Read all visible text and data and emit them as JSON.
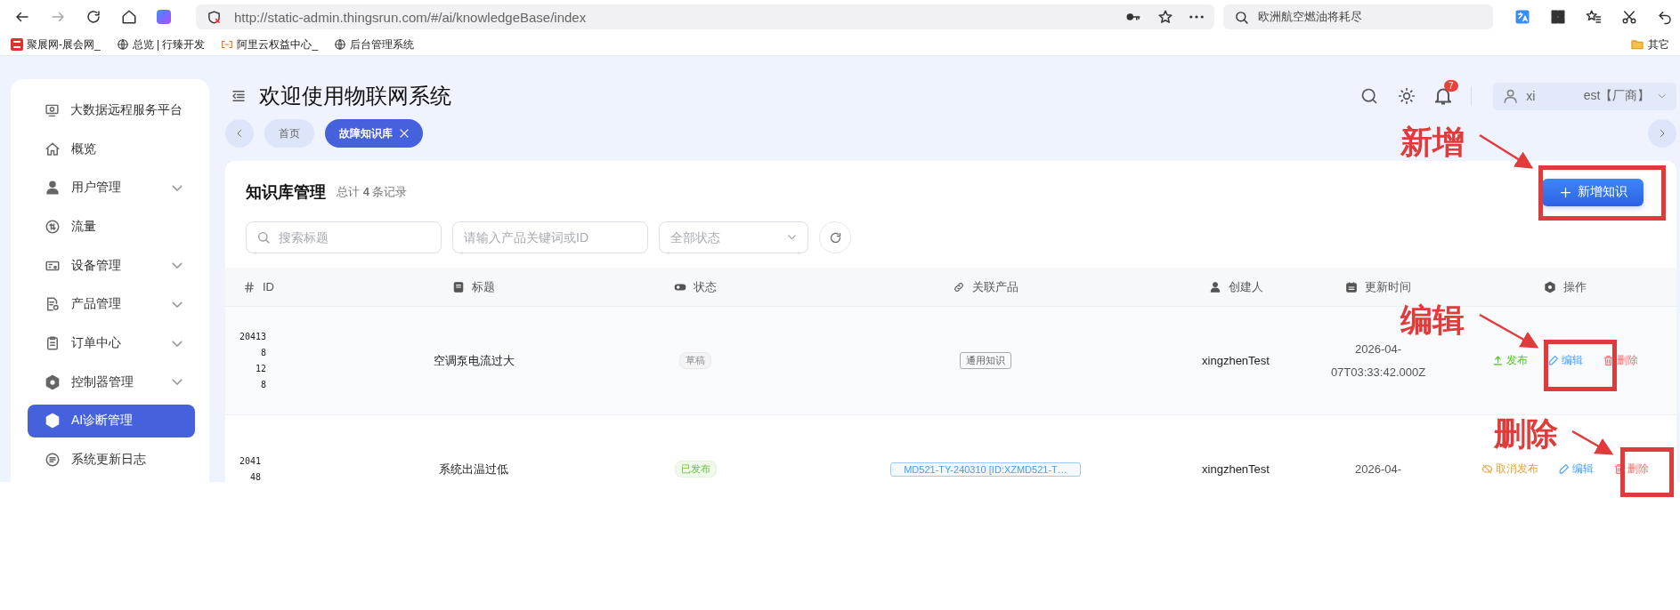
{
  "browser": {
    "url": "http://static-admin.thingsrun.com/#/ai/knowledgeBase/index",
    "search": "欧洲航空燃油将耗尽",
    "bookmarks": [
      {
        "label": "聚展网-展会网_",
        "kind": "expo"
      },
      {
        "label": "总览 | 行臻开发",
        "kind": "globe"
      },
      {
        "label": "阿里云权益中心_",
        "kind": "cloud"
      },
      {
        "label": "后台管理系统",
        "kind": "globe"
      }
    ],
    "other_bookmarks": "其它"
  },
  "sidebar": {
    "items": [
      {
        "label": "大数据远程服务平台",
        "kind": "monitor",
        "expandable": false,
        "selected": false
      },
      {
        "label": "概览",
        "kind": "home",
        "expandable": false,
        "selected": false
      },
      {
        "label": "用户管理",
        "kind": "user",
        "expandable": true,
        "selected": false
      },
      {
        "label": "流量",
        "kind": "flow",
        "expandable": false,
        "selected": false
      },
      {
        "label": "设备管理",
        "kind": "device",
        "expandable": true,
        "selected": false
      },
      {
        "label": "产品管理",
        "kind": "product",
        "expandable": true,
        "selected": false
      },
      {
        "label": "订单中心",
        "kind": "order",
        "expandable": true,
        "selected": false
      },
      {
        "label": "控制器管理",
        "kind": "gear",
        "expandable": true,
        "selected": false
      },
      {
        "label": "AI诊断管理",
        "kind": "gear",
        "expandable": false,
        "selected": true
      },
      {
        "label": "系统更新日志",
        "kind": "log",
        "expandable": false,
        "selected": false
      }
    ]
  },
  "header": {
    "title": "欢迎使用物联网系统",
    "notifications": "7",
    "user_start": "xi",
    "user_end": "est【厂商】"
  },
  "tabs": [
    {
      "label": "首页",
      "selected": false,
      "closable": false
    },
    {
      "label": "故障知识库",
      "selected": true,
      "closable": true
    }
  ],
  "card": {
    "title": "知识库管理",
    "count": "总计 **4** 条记录",
    "add_button": "新增知识"
  },
  "filters": {
    "title_placeholder": "搜索标题",
    "product_placeholder": "请输入产品关键词或ID",
    "status_placeholder": "全部状态"
  },
  "table": {
    "columns": [
      "ID",
      "标题",
      "状态",
      "关联产品",
      "创建人",
      "更新时间",
      "操作"
    ],
    "rows": [
      {
        "id_lines": [
          "20413",
          "8",
          "12",
          "8"
        ],
        "title": "空调泵电流过大",
        "status": "草稿",
        "published": false,
        "product": "通用知识",
        "product_linked": false,
        "creator": "xingzhenTest",
        "time_lines": [
          "2026-04-",
          "07T03:33:42.000Z"
        ],
        "actions": [
          {
            "label": "发布",
            "kind": "publish"
          },
          {
            "label": "编辑",
            "kind": "edit"
          },
          {
            "label": "删除",
            "kind": "delete"
          }
        ]
      },
      {
        "id_lines": [
          "2041",
          "48"
        ],
        "title": "系统出温过低",
        "status": "已发布",
        "published": true,
        "product": "MD521-TY-240310 [ID:XZMD521-T…",
        "product_linked": true,
        "creator": "xingzhenTest",
        "time_lines": [
          "2026-04-"
        ],
        "actions": [
          {
            "label": "取消发布",
            "kind": "unpublish"
          },
          {
            "label": "编辑",
            "kind": "edit"
          },
          {
            "label": "删除",
            "kind": "delete"
          }
        ]
      }
    ]
  },
  "annotations": [
    {
      "label": "新增"
    },
    {
      "label": "编辑"
    },
    {
      "label": "删除"
    }
  ]
}
